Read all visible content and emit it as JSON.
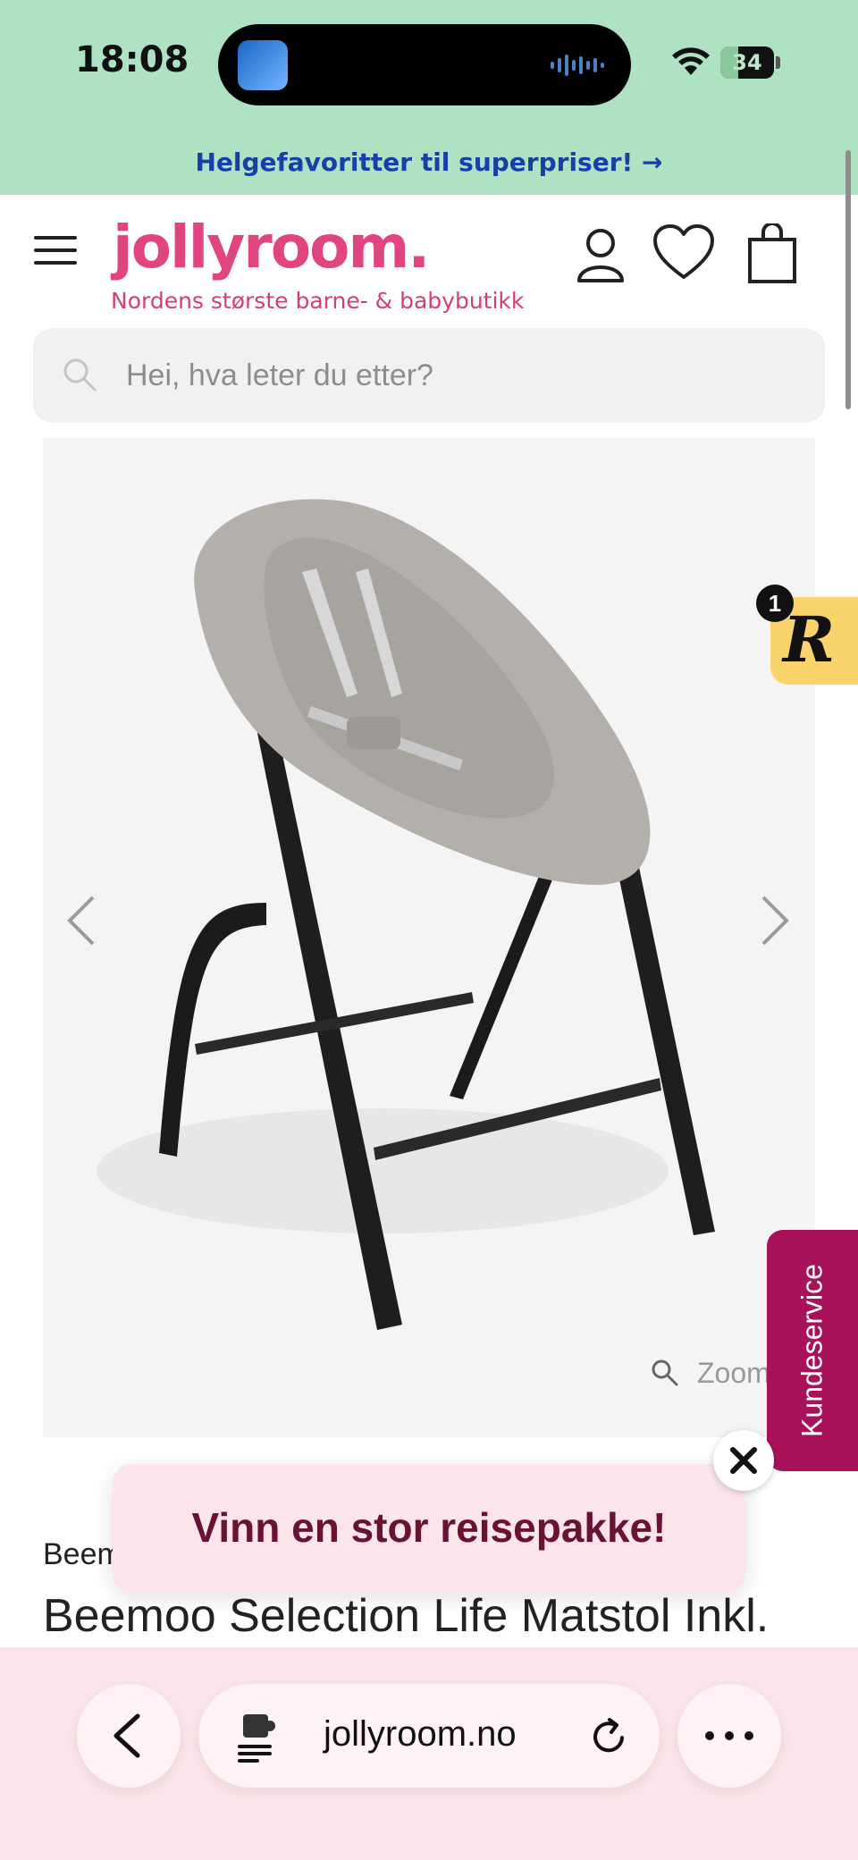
{
  "status_bar": {
    "time": "18:08",
    "battery": "34",
    "battery_level": 0.34,
    "icons": [
      "wifi-icon",
      "battery-icon",
      "audio-wave-icon"
    ]
  },
  "promo_banner": {
    "text": "Helgefavoritter til superpriser! →"
  },
  "header": {
    "logo": "jollyroom.",
    "tagline": "Nordens største barne- & babybutikk",
    "brand_color": "#e0457f",
    "icons": [
      "menu-icon",
      "account-icon",
      "wishlist-heart-icon",
      "cart-bag-icon"
    ]
  },
  "search": {
    "placeholder": "Hei, hva leter du etter?"
  },
  "gallery": {
    "zoom_label": "Zoom",
    "icons": [
      "chevron-left-icon",
      "chevron-right-icon",
      "zoom-magnifier-icon"
    ]
  },
  "floating_badge": {
    "count": "1",
    "letter": "R",
    "color": "#f8d46a"
  },
  "customer_service": {
    "label": "Kundeservice",
    "color": "#a8125a"
  },
  "popup": {
    "text": "Vinn en stor reisepakke!",
    "color": "#fbe5ea"
  },
  "product": {
    "brand": "Beemoo",
    "title": "Beemoo Selection Life Matstol Inkl."
  },
  "browser": {
    "url": "jollyroom.no",
    "icons": [
      "back-chevron-icon",
      "site-settings-icon",
      "reload-icon",
      "more-dots-icon"
    ]
  }
}
